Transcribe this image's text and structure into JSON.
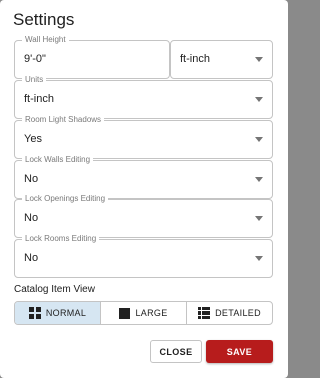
{
  "dialog": {
    "title": "Settings"
  },
  "fields": {
    "wall_height": {
      "label": "Wall Height",
      "value": "9'-0\""
    },
    "wall_height_unit": {
      "value": "ft-inch"
    },
    "units": {
      "label": "Units",
      "value": "ft-inch"
    },
    "room_light_shadows": {
      "label": "Room Light Shadows",
      "value": "Yes"
    },
    "lock_walls": {
      "label": "Lock Walls Editing",
      "value": "No"
    },
    "lock_openings": {
      "label": "Lock Openings Editing",
      "value": "No"
    },
    "lock_rooms": {
      "label": "Lock Rooms Editing",
      "value": "No"
    }
  },
  "catalog_view": {
    "label": "Catalog Item View",
    "options": [
      {
        "label": "NORMAL",
        "icon": "grid-icon",
        "selected": true
      },
      {
        "label": "LARGE",
        "icon": "square-icon",
        "selected": false
      },
      {
        "label": "DETAILED",
        "icon": "list-icon",
        "selected": false
      }
    ]
  },
  "actions": {
    "close_label": "CLOSE",
    "save_label": "SAVE"
  },
  "colors": {
    "accent": "#b71c1c",
    "selected_toggle_bg": "#d6e6f2"
  }
}
